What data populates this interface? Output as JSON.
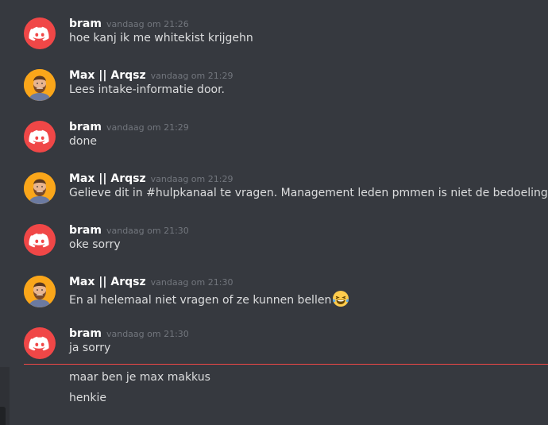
{
  "messages": [
    {
      "author": "bram",
      "avatar": "discord-logo-avatar",
      "time": "vandaag om 21:26",
      "text": "hoe kanj ik me whitekist krijgehn"
    },
    {
      "author": "Max || Arqsz",
      "avatar": "bearded-man-avatar",
      "time": "vandaag om 21:29",
      "text": "Lees intake-informatie door."
    },
    {
      "author": "bram",
      "avatar": "discord-logo-avatar",
      "time": "vandaag om 21:29",
      "text": "done"
    },
    {
      "author": "Max || Arqsz",
      "avatar": "bearded-man-avatar",
      "time": "vandaag om 21:29",
      "text": "Gelieve dit in #hulpkanaal te vragen. Management leden pmmen is niet de bedoeling."
    },
    {
      "author": "bram",
      "avatar": "discord-logo-avatar",
      "time": "vandaag om 21:30",
      "text": "oke sorry"
    },
    {
      "author": "Max || Arqsz",
      "avatar": "bearded-man-avatar",
      "time": "vandaag om 21:30",
      "text": "En al helemaal niet vragen of ze kunnen bellen",
      "emoji": "laughing-crying-emoji"
    },
    {
      "author": "bram",
      "avatar": "discord-logo-avatar",
      "time": "vandaag om 21:30",
      "text": "ja sorry"
    }
  ],
  "continuation": [
    "maar ben je max makkus",
    "henkie"
  ],
  "colors": {
    "background": "#36393f",
    "username": "#ffffff",
    "text": "#dcddde",
    "timestamp": "#72767d",
    "discord_red": "#f04747",
    "new_divider": "#f04747"
  }
}
